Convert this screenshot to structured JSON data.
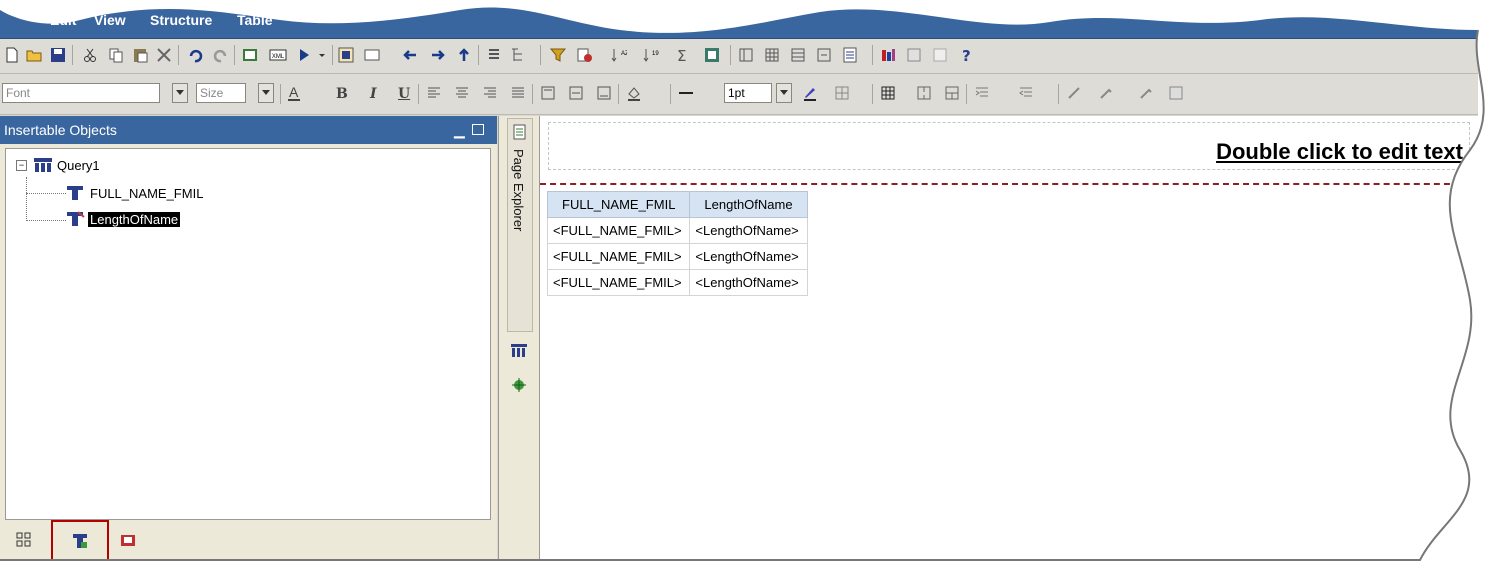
{
  "menubar": {
    "items": [
      {
        "label": "Edit"
      },
      {
        "label": "View"
      },
      {
        "label": "Structure"
      },
      {
        "label": "Table"
      }
    ]
  },
  "formatbar": {
    "font_placeholder": "Font",
    "size_placeholder": "Size",
    "border_width": "1pt"
  },
  "left_panel": {
    "title": "Insertable Objects",
    "tree": {
      "query": "Query1",
      "items": [
        {
          "label": "FULL_NAME_FMIL"
        },
        {
          "label": "LengthOfName"
        }
      ]
    }
  },
  "explorer": {
    "tab_label": "Page Explorer"
  },
  "canvas": {
    "header_text": "Double click to edit text",
    "table": {
      "headers": [
        "FULL_NAME_FMIL",
        "LengthOfName"
      ],
      "rows": [
        [
          "<FULL_NAME_FMIL>",
          "<LengthOfName>"
        ],
        [
          "<FULL_NAME_FMIL>",
          "<LengthOfName>"
        ],
        [
          "<FULL_NAME_FMIL>",
          "<LengthOfName>"
        ]
      ]
    }
  },
  "colors": {
    "menubar": "#3a66a0",
    "panel": "#ece9d8",
    "header_cell": "#d5e3f3",
    "highlight": "#b40000"
  }
}
